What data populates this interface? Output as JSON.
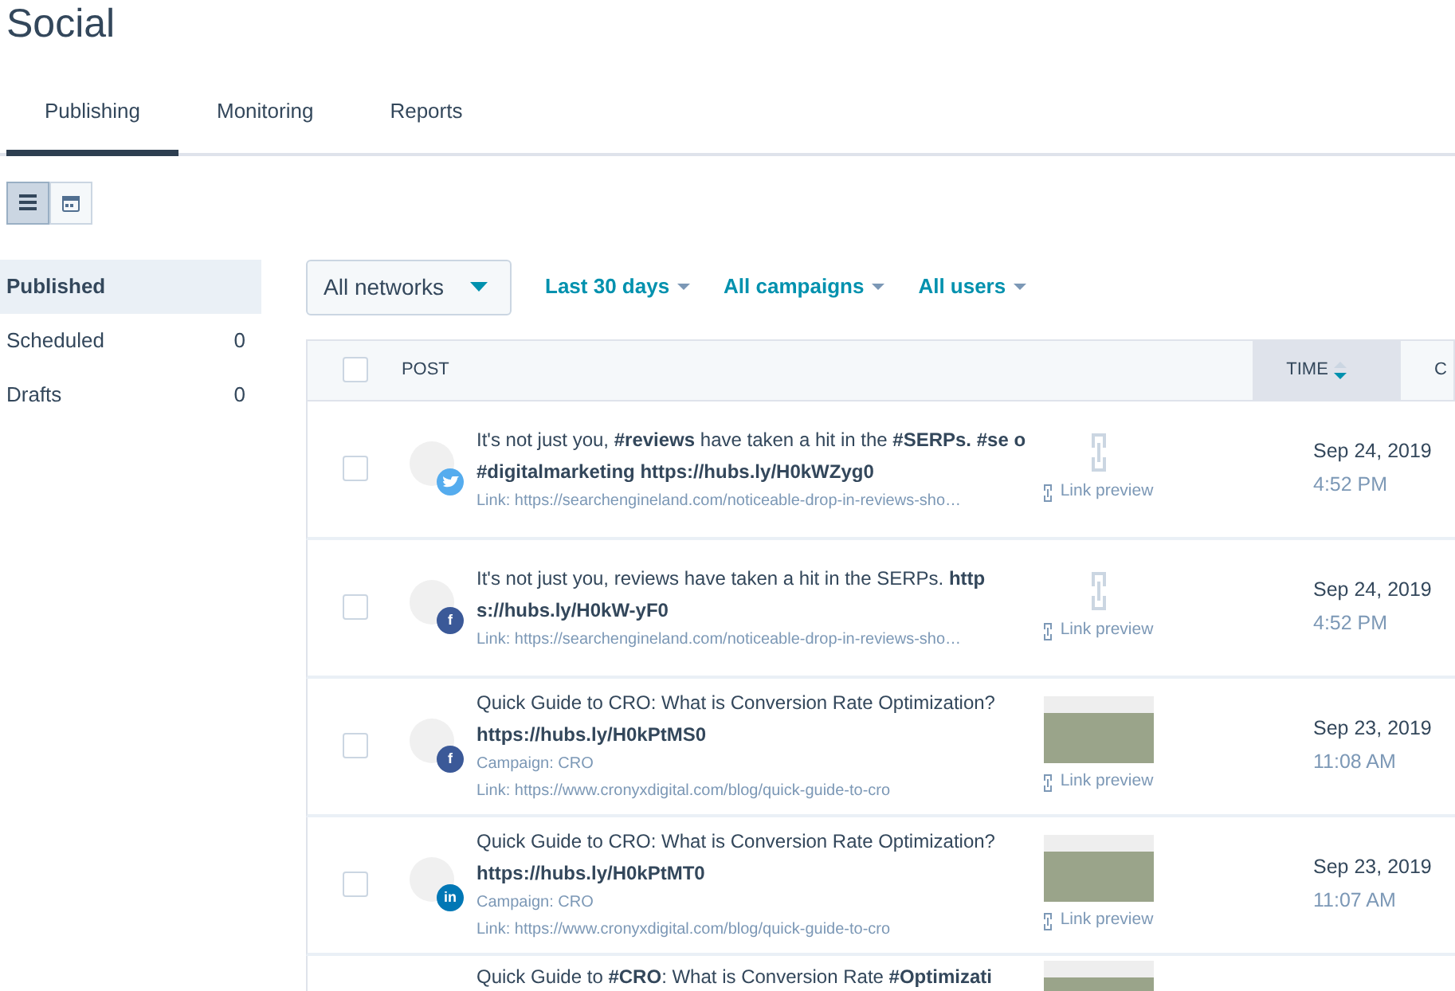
{
  "page_title": "Social",
  "tabs": [
    {
      "label": "Publishing",
      "selected": true
    },
    {
      "label": "Monitoring",
      "selected": false
    },
    {
      "label": "Reports",
      "selected": false
    }
  ],
  "view_toggle": [
    {
      "kind": "list",
      "selected": true
    },
    {
      "kind": "calendar",
      "selected": false
    }
  ],
  "sidebar": {
    "items": [
      {
        "label": "Published",
        "selected": true
      },
      {
        "label": "Scheduled",
        "count": "0",
        "selected": false
      },
      {
        "label": "Drafts",
        "count": "0",
        "selected": false
      }
    ]
  },
  "filters": {
    "network_select": "All networks",
    "dropdowns": [
      "Last 30 days",
      "All campaigns",
      "All users"
    ]
  },
  "table": {
    "select_all_checked": false,
    "columns": [
      {
        "label": "POST",
        "sorted": false
      },
      {
        "label": "TIME",
        "sorted": true
      },
      {
        "label": "C",
        "sorted": false
      }
    ],
    "rows": [
      {
        "checked": false,
        "badge": {
          "kind": "bird",
          "color": "#55acee"
        },
        "text": "It's not just you, **#reviews** have taken a hit in the **#SERPs. #se** **o #digitalmarketing https://hubs.ly/H0kWZyg0**",
        "link": "Link: https://searchengineland.com/noticeable-drop-in-reviews-sho…",
        "preview": {
          "kind": "link",
          "label": "Link preview"
        },
        "date": "Sep 24, 2019",
        "time": "4:52 PM"
      },
      {
        "checked": false,
        "badge": {
          "kind": "letter",
          "color": "#3b5998",
          "glyph": "f"
        },
        "text": "It's not just you, reviews have taken a hit in the SERPs. **http** **s://hubs.ly/H0kW-yF0**",
        "link": "Link: https://searchengineland.com/noticeable-drop-in-reviews-sho…",
        "preview": {
          "kind": "link",
          "label": "Link preview"
        },
        "date": "Sep 24, 2019",
        "time": "4:52 PM"
      },
      {
        "checked": false,
        "badge": {
          "kind": "letter",
          "color": "#3b5998",
          "glyph": "f"
        },
        "text": "Quick Guide to CRO: What is Conversion Rate Optimization? **https://hubs.ly/H0kPtMS0**",
        "campaign": "Campaign: CRO",
        "link": "Link: https://www.cronyxdigital.com/blog/quick-guide-to-cro",
        "preview": {
          "kind": "image",
          "label": "Link preview"
        },
        "date": "Sep 23, 2019",
        "time": "11:08 AM"
      },
      {
        "checked": false,
        "badge": {
          "kind": "letter",
          "color": "#0077b5",
          "glyph": "in"
        },
        "text": "Quick Guide to CRO: What is Conversion Rate Optimization? **https://hubs.ly/H0kPtMT0**",
        "campaign": "Campaign: CRO",
        "link": "Link: https://www.cronyxdigital.com/blog/quick-guide-to-cro",
        "preview": {
          "kind": "image",
          "label": "Link preview"
        },
        "date": "Sep 23, 2019",
        "time": "11:07 AM"
      },
      {
        "text": "Quick Guide to **#CRO**: What is Conversion Rate **#Optimizati**",
        "preview": {
          "kind": "image"
        }
      }
    ]
  }
}
